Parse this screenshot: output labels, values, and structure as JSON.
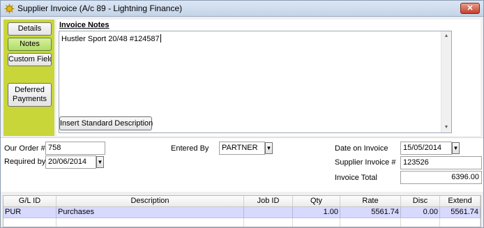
{
  "window": {
    "title": "Supplier Invoice (A/c 89 - Lightning Finance)",
    "close_label": "✕",
    "icon": "sun-gear-icon",
    "accent_color": "#c8d63a"
  },
  "sidebar": {
    "items": [
      {
        "label": "Details",
        "active": false
      },
      {
        "label": "Notes",
        "active": true
      },
      {
        "label": "Custom Fields",
        "active": false
      },
      {
        "label": "Deferred Payments",
        "active": false
      }
    ]
  },
  "notes": {
    "title": "Invoice Notes",
    "text": "Hustler Sport 20/48 #124587",
    "insert_button": "Insert Standard Description"
  },
  "form": {
    "our_order_label": "Our Order #",
    "our_order_value": "758",
    "required_by_label": "Required by",
    "required_by_value": "20/06/2014",
    "entered_by_label": "Entered By",
    "entered_by_value": "PARTNER",
    "date_on_invoice_label": "Date on Invoice",
    "date_on_invoice_value": "15/05/2014",
    "supplier_invoice_label": "Supplier Invoice #",
    "supplier_invoice_value": "123526",
    "invoice_total_label": "Invoice Total",
    "invoice_total_value": "6396.00"
  },
  "grid": {
    "columns": [
      "G/L ID",
      "Description",
      "Job ID",
      "Qty",
      "Rate",
      "Disc",
      "Extend"
    ],
    "rows": [
      [
        "PUR",
        "Purchases",
        "",
        "1.00",
        "5561.74",
        "0.00",
        "5561.74"
      ]
    ]
  }
}
